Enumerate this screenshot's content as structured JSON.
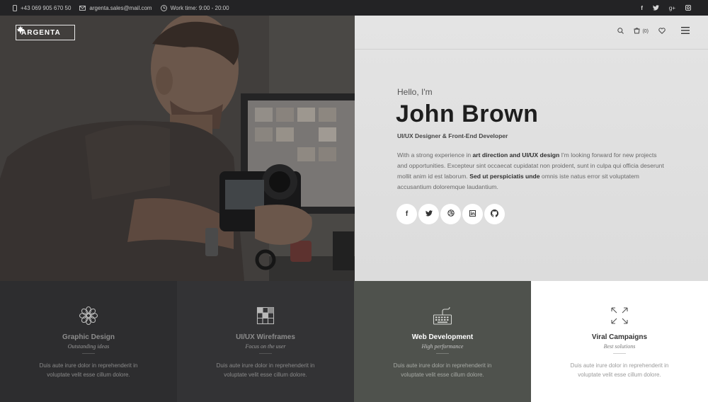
{
  "topbar": {
    "phone": "+43 069 905 670 50",
    "email": "argenta.sales@mail.com",
    "hours": "Work time: 9:00 - 20:00",
    "social": [
      "f",
      "t",
      "g+",
      "ig"
    ]
  },
  "header": {
    "logo": "ARGENTA",
    "cart_count": "(0)"
  },
  "hero": {
    "greeting": "Hello, I'm",
    "name": "John Brown",
    "role": "UI/UX Designer & Front-End Developer",
    "bio_1": "With a strong experience in ",
    "bio_bold_1": "art direction and UI/UX design",
    "bio_2": " I'm looking forward for new projects and opportunities. Excepteur sint occaecat cupidatat non proident, sunt in culpa qui officia deserunt mollit anim id est laborum. ",
    "bio_bold_2": "Sed ut perspiciatis unde",
    "bio_3": " omnis iste natus error sit voluptatem accusantium doloremque laudantium.",
    "social_buttons": [
      "facebook-icon",
      "twitter-icon",
      "dribbble-icon",
      "linkedin-icon",
      "github-icon"
    ]
  },
  "services": [
    {
      "title": "Graphic Design",
      "subtitle": "Outstanding ideas",
      "desc": "Duis aute irure dolor in reprehenderit in voluptate velit esse cillum dolore.",
      "icon": "flower-icon"
    },
    {
      "title": "UI/UX Wireframes",
      "subtitle": "Focus on the user",
      "desc": "Duis aute irure dolor in reprehenderit in voluptate velit esse cillum dolore.",
      "icon": "grid-layout-icon"
    },
    {
      "title": "Web Development",
      "subtitle": "High performance",
      "desc": "Duis aute irure dolor in reprehenderit in voluptate velit esse cillum dolore.",
      "icon": "keyboard-icon"
    },
    {
      "title": "Viral Campaigns",
      "subtitle": "Best solutions",
      "desc": "Duis aute irure dolor in reprehenderit in voluptate velit esse cillum dolore.",
      "icon": "expand-arrows-icon"
    }
  ],
  "colors": {
    "topbar": "#232325",
    "panel_dark": "#2d2d2f",
    "panel_mid": "#333335",
    "panel_active": "#4f524d",
    "panel_light": "#ffffff"
  }
}
